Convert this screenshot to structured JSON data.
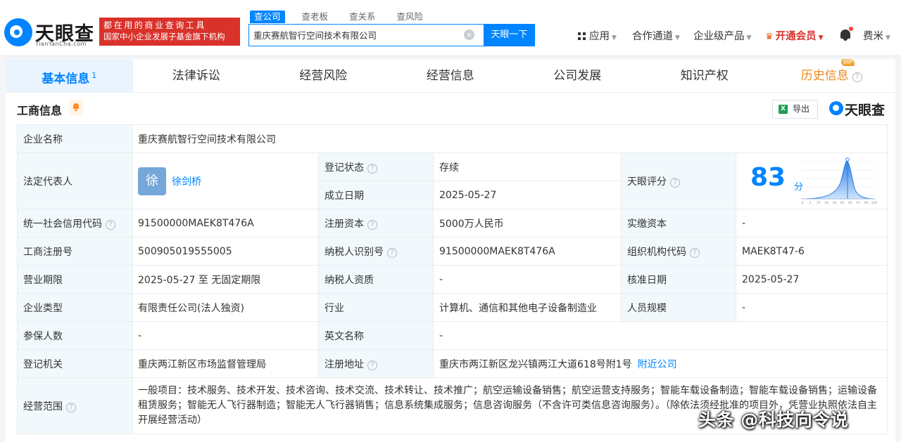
{
  "logo": {
    "cn": "天眼查",
    "en": "TianYanCha.com"
  },
  "slogan": {
    "line1": "都在用的商业查询工具",
    "line2": "国家中小企业发展子基金旗下机构"
  },
  "search": {
    "tabs": [
      "查公司",
      "查老板",
      "查关系",
      "查风险"
    ],
    "value": "重庆赛航智行空间技术有限公司",
    "button": "天眼一下"
  },
  "nav": {
    "apps": "应用",
    "channel": "合作通道",
    "enterprise": "企业级产品",
    "vip": "开通会员",
    "user": "费米"
  },
  "tabs": [
    {
      "label": "基本信息",
      "count": "1"
    },
    {
      "label": "法律诉讼"
    },
    {
      "label": "经营风险"
    },
    {
      "label": "经营信息"
    },
    {
      "label": "公司发展"
    },
    {
      "label": "知识产权"
    },
    {
      "label": "历史信息",
      "badge": "VIP"
    }
  ],
  "section": {
    "title": "工商信息",
    "export": "导出",
    "brand": "天眼查"
  },
  "info": {
    "company_name_label": "企业名称",
    "company_name": "重庆赛航智行空间技术有限公司",
    "legal_rep_label": "法定代表人",
    "legal_rep_avatar": "徐",
    "legal_rep": "徐剑桥",
    "reg_status_label": "登记状态",
    "reg_status": "存续",
    "founded_label": "成立日期",
    "founded": "2025-05-27",
    "score_label": "天眼评分",
    "score": "83",
    "score_unit": "分",
    "score_axis": [
      "0",
      "5",
      "15",
      "30",
      "50",
      "65",
      "85",
      "97",
      "99",
      "100"
    ],
    "credit_code_label": "统一社会信用代码",
    "credit_code": "91500000MAEK8T476A",
    "reg_capital_label": "注册资本",
    "reg_capital": "5000万人民币",
    "paid_capital_label": "实缴资本",
    "paid_capital": "-",
    "reg_no_label": "工商注册号",
    "reg_no": "500905019555005",
    "taxpayer_id_label": "纳税人识别号",
    "taxpayer_id": "91500000MAEK8T476A",
    "org_code_label": "组织机构代码",
    "org_code": "MAEK8T47-6",
    "term_label": "营业期限",
    "term": "2025-05-27 至 无固定期限",
    "taxpayer_qual_label": "纳税人资质",
    "taxpayer_qual": "-",
    "approve_date_label": "核准日期",
    "approve_date": "2025-05-27",
    "type_label": "企业类型",
    "type": "有限责任公司(法人独资)",
    "industry_label": "行业",
    "industry": "计算机、通信和其他电子设备制造业",
    "staff_label": "人员规模",
    "staff": "-",
    "insured_label": "参保人数",
    "insured": "-",
    "en_name_label": "英文名称",
    "en_name": "-",
    "authority_label": "登记机关",
    "authority": "重庆两江新区市场监督管理局",
    "address_label": "注册地址",
    "address": "重庆市两江新区龙兴镇两江大道618号附1号",
    "nearby": "附近公司",
    "scope_label": "经营范围",
    "scope": "一般项目：技术服务、技术开发、技术咨询、技术交流、技术转让、技术推广；航空运输设备销售；航空运营支持服务；智能车载设备制造；智能车载设备销售；运输设备租赁服务；智能无人飞行器制造；智能无人飞行器销售；信息系统集成服务；信息咨询服务（不含许可类信息咨询服务）。（除依法须经批准的项目外，凭营业执照依法自主开展经营活动）"
  },
  "watermark": "头条 @科技向令说",
  "colors": {
    "brand": "#0084ff",
    "slogan_bg": "#d9322b",
    "status_green": "#16a34a",
    "vip": "#e98a1c"
  }
}
